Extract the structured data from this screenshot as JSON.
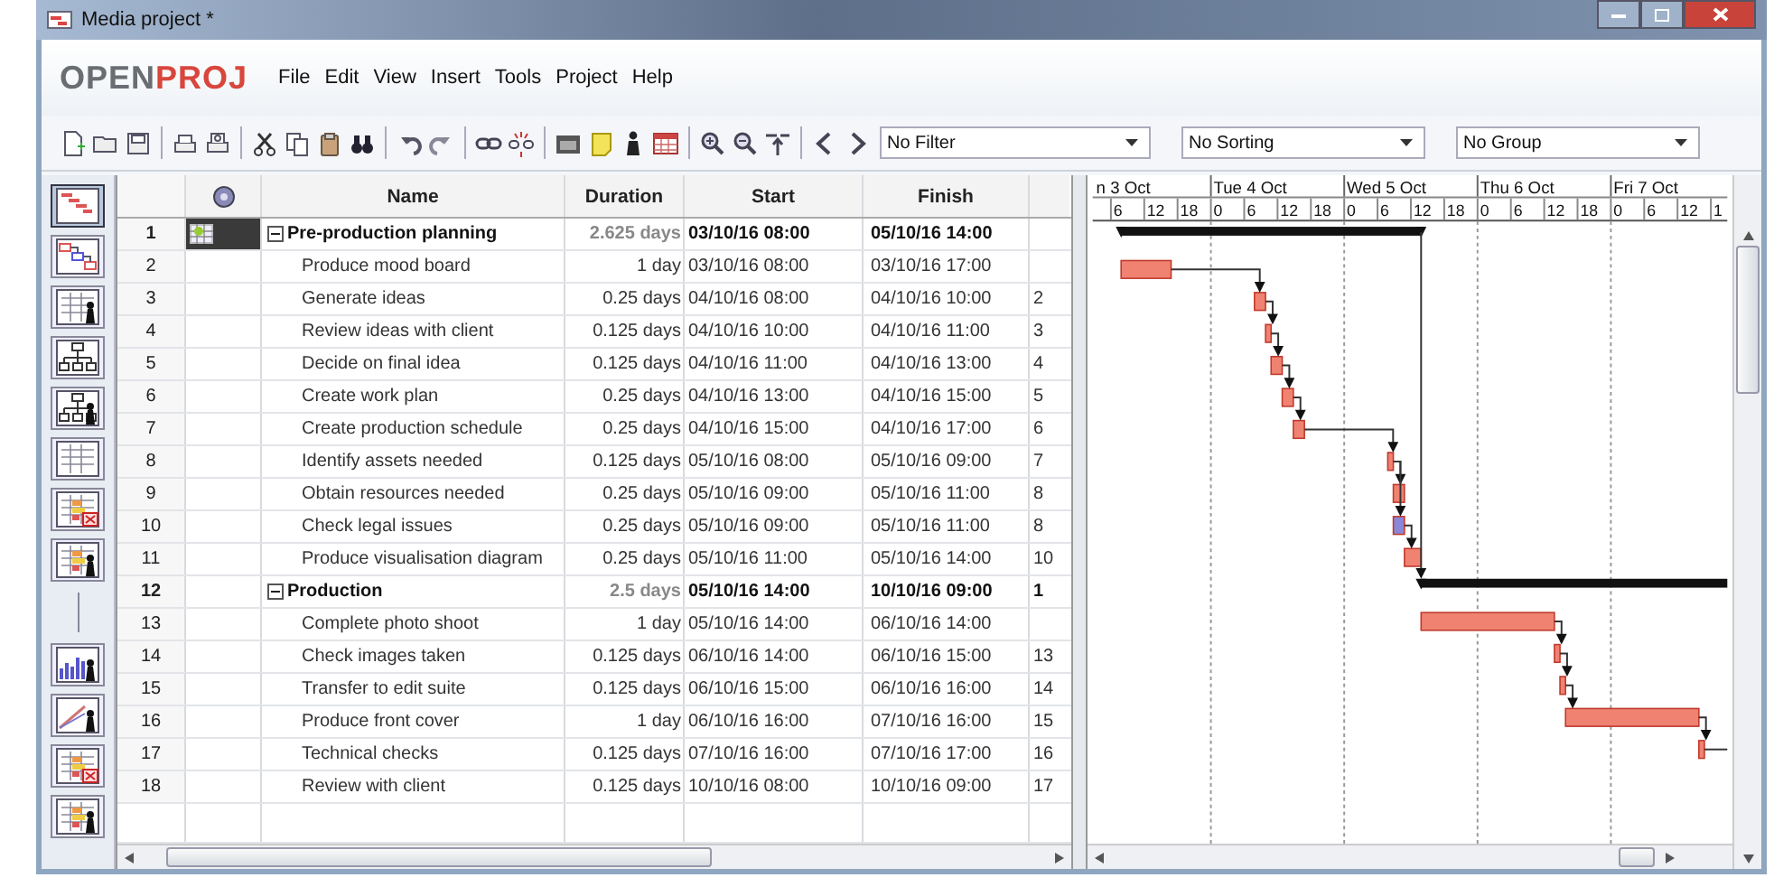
{
  "window": {
    "title": "Media project *"
  },
  "logo": {
    "parts": [
      "OPEN",
      "PROJ"
    ]
  },
  "menu": [
    "File",
    "Edit",
    "View",
    "Insert",
    "Tools",
    "Project",
    "Help"
  ],
  "filters": [
    {
      "value": "No Filter"
    },
    {
      "value": "No Sorting"
    },
    {
      "value": "No Group"
    }
  ],
  "views": [
    {
      "kind": "gantt",
      "selected": true
    },
    {
      "kind": "network",
      "selected": false
    },
    {
      "kind": "resources",
      "selected": false
    },
    {
      "kind": "wbs",
      "selected": false
    },
    {
      "kind": "rbs",
      "selected": false
    },
    {
      "kind": "grid",
      "selected": false
    },
    {
      "kind": "task-usage",
      "selected": false
    },
    {
      "kind": "resource-usage",
      "selected": false
    },
    {
      "kind": "separator"
    },
    {
      "kind": "histogram",
      "selected": false
    },
    {
      "kind": "charts",
      "selected": false
    },
    {
      "kind": "task-usage",
      "selected": false
    },
    {
      "kind": "resource-usage",
      "selected": false
    }
  ],
  "table": {
    "columns": [
      "Name",
      "Duration",
      "Start",
      "Finish"
    ],
    "tasks": [
      {
        "id": "1",
        "name": "Pre-production planning",
        "kind": "summary",
        "expanded": true,
        "selected": true,
        "duration": "2.625 days",
        "start": "03/10/16 08:00",
        "finish": "05/10/16 14:00",
        "children": [
          {
            "id": "2",
            "name": "Produce mood board",
            "kind": "task",
            "color": "#f08272",
            "selected": false,
            "duration": "1 day",
            "start": "03/10/16 08:00",
            "finish": "03/10/16 17:00"
          },
          {
            "id": "3",
            "name": "Generate ideas",
            "kind": "task",
            "color": "#f08272",
            "selected": false,
            "duration": "0.25 days",
            "start": "04/10/16 08:00",
            "finish": "04/10/16 10:00",
            "predecessors": "2"
          },
          {
            "id": "4",
            "name": "Review ideas with client",
            "kind": "task",
            "color": "#f08272",
            "selected": false,
            "duration": "0.125 days",
            "start": "04/10/16 10:00",
            "finish": "04/10/16 11:00",
            "predecessors": "3"
          },
          {
            "id": "5",
            "name": "Decide on final idea",
            "kind": "task",
            "color": "#f08272",
            "selected": false,
            "duration": "0.125 days",
            "start": "04/10/16 11:00",
            "finish": "04/10/16 13:00",
            "predecessors": "4"
          },
          {
            "id": "6",
            "name": "Create work plan",
            "kind": "task",
            "color": "#f08272",
            "selected": false,
            "duration": "0.25 days",
            "start": "04/10/16 13:00",
            "finish": "04/10/16 15:00",
            "predecessors": "5"
          },
          {
            "id": "7",
            "name": "Create production schedule",
            "kind": "task",
            "color": "#f08272",
            "selected": false,
            "duration": "0.25 days",
            "start": "04/10/16 15:00",
            "finish": "04/10/16 17:00",
            "predecessors": "6"
          },
          {
            "id": "8",
            "name": "Identify assets needed",
            "kind": "task",
            "color": "#f08272",
            "selected": false,
            "duration": "0.125 days",
            "start": "05/10/16 08:00",
            "finish": "05/10/16 09:00",
            "predecessors": "7"
          },
          {
            "id": "9",
            "name": "Obtain resources needed",
            "kind": "task",
            "color": "#f08272",
            "selected": false,
            "duration": "0.25 days",
            "start": "05/10/16 09:00",
            "finish": "05/10/16 11:00",
            "predecessors": "8"
          },
          {
            "id": "10",
            "name": "Check legal issues",
            "kind": "task",
            "color": "#8a86d8",
            "selected": false,
            "duration": "0.25 days",
            "start": "05/10/16 09:00",
            "finish": "05/10/16 11:00",
            "predecessors": "8"
          },
          {
            "id": "11",
            "name": "Produce visualisation diagram",
            "kind": "task",
            "color": "#f08272",
            "selected": false,
            "duration": "0.25 days",
            "start": "05/10/16 11:00",
            "finish": "05/10/16 14:00",
            "predecessors": "10"
          }
        ]
      },
      {
        "id": "12",
        "name": "Production",
        "kind": "summary",
        "expanded": true,
        "selected": false,
        "duration": "2.5 days",
        "start": "05/10/16 14:00",
        "finish": "10/10/16 09:00",
        "predecessors": "1",
        "children": [
          {
            "id": "13",
            "name": "Complete photo shoot",
            "kind": "task",
            "color": "#f08272",
            "selected": false,
            "duration": "1 day",
            "start": "05/10/16 14:00",
            "finish": "06/10/16 14:00"
          },
          {
            "id": "14",
            "name": "Check images taken",
            "kind": "task",
            "color": "#f08272",
            "selected": false,
            "duration": "0.125 days",
            "start": "06/10/16 14:00",
            "finish": "06/10/16 15:00",
            "predecessors": "13"
          },
          {
            "id": "15",
            "name": "Transfer to edit suite",
            "kind": "task",
            "color": "#f08272",
            "selected": false,
            "duration": "0.125 days",
            "start": "06/10/16 15:00",
            "finish": "06/10/16 16:00",
            "predecessors": "14"
          },
          {
            "id": "16",
            "name": "Produce front cover",
            "kind": "task",
            "color": "#f08272",
            "selected": false,
            "duration": "1 day",
            "start": "06/10/16 16:00",
            "finish": "07/10/16 16:00",
            "predecessors": "15"
          },
          {
            "id": "17",
            "name": "Technical checks",
            "kind": "task",
            "color": "#f08272",
            "selected": false,
            "duration": "0.125 days",
            "start": "07/10/16 16:00",
            "finish": "07/10/16 17:00",
            "predecessors": "16"
          },
          {
            "id": "18",
            "name": "Review with client",
            "kind": "task",
            "selected": false,
            "duration": "0.125 days",
            "start": "10/10/16 08:00",
            "finish": "10/10/16 09:00",
            "predecessors": "17"
          }
        ]
      }
    ]
  },
  "timeline": {
    "days": [
      "n 3 Oct",
      "Tue 4 Oct",
      "Wed 5 Oct",
      "Thu 6 Oct",
      "Fri 7 Oct"
    ],
    "hours": [
      "6",
      "12",
      "18",
      "0",
      "6",
      "12",
      "18",
      "0",
      "6",
      "12",
      "18",
      "0",
      "6",
      "12",
      "18",
      "0",
      "6",
      "12",
      "1"
    ]
  }
}
